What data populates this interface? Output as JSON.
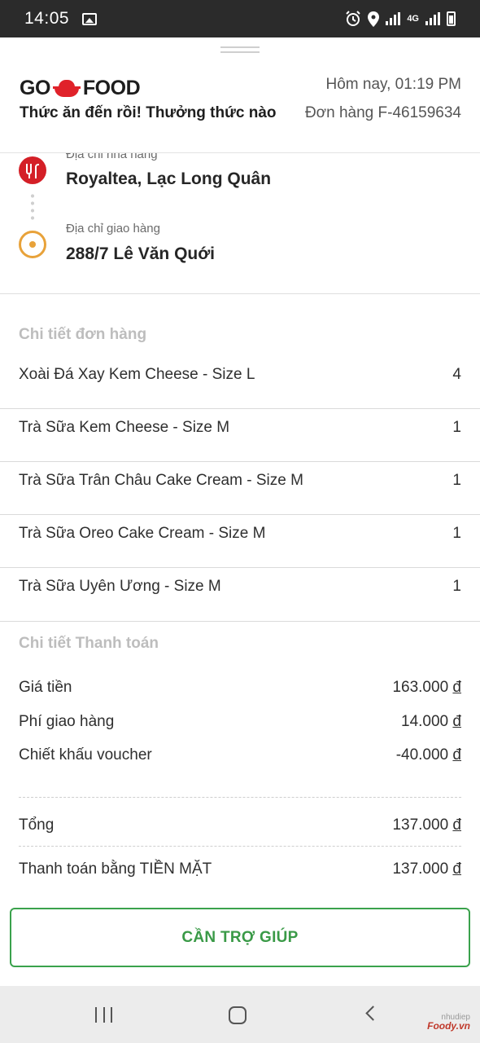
{
  "status_bar": {
    "time": "14:05",
    "network_label": "4G",
    "icons": [
      "gallery-icon",
      "alarm-icon",
      "location-icon",
      "wifi-icon",
      "signal-icon",
      "battery-icon"
    ]
  },
  "header": {
    "brand_left": "GO",
    "brand_right": "FOOD",
    "title": "Thức ăn đến rồi! Thưởng thức nào",
    "date": "Hôm nay, 01:19 PM",
    "order_id": "Đơn hàng F-46159634"
  },
  "addresses": {
    "restaurant_label": "Địa chỉ nhà hàng",
    "restaurant": "Royaltea, Lạc Long Quân",
    "delivery_label": "Địa chỉ giao hàng",
    "delivery": "288/7 Lê Văn Quới"
  },
  "order": {
    "title": "Chi tiết đơn hàng",
    "items": [
      {
        "name": "Xoài Đá Xay Kem Cheese - Size L",
        "qty": "4"
      },
      {
        "name": "Trà Sữa Kem Cheese - Size M",
        "qty": "1"
      },
      {
        "name": "Trà Sữa Trân Châu Cake Cream - Size M",
        "qty": "1"
      },
      {
        "name": "Trà Sữa Oreo Cake Cream - Size M",
        "qty": "1"
      },
      {
        "name": "Trà Sữa Uyên Ương - Size M",
        "qty": "1"
      }
    ]
  },
  "payment": {
    "title": "Chi tiết Thanh toán",
    "currency": "đ",
    "price_label": "Giá tiền",
    "price": "163.000",
    "delivery_fee_label": "Phí giao hàng",
    "delivery_fee": "14.000",
    "voucher_label": "Chiết khấu voucher",
    "voucher": "-40.000",
    "total_label": "Tổng",
    "total": "137.000",
    "cash_label": "Thanh toán bằng TIỀN MẶT",
    "cash": "137.000"
  },
  "help_button": "CẦN TRỢ GIÚP",
  "watermark": {
    "line1": "nhudiep",
    "line2": "Foody.vn"
  },
  "colors": {
    "brand_red": "#e0222a",
    "help_green": "#3aa24c",
    "pin_orange": "#e8a23a"
  }
}
